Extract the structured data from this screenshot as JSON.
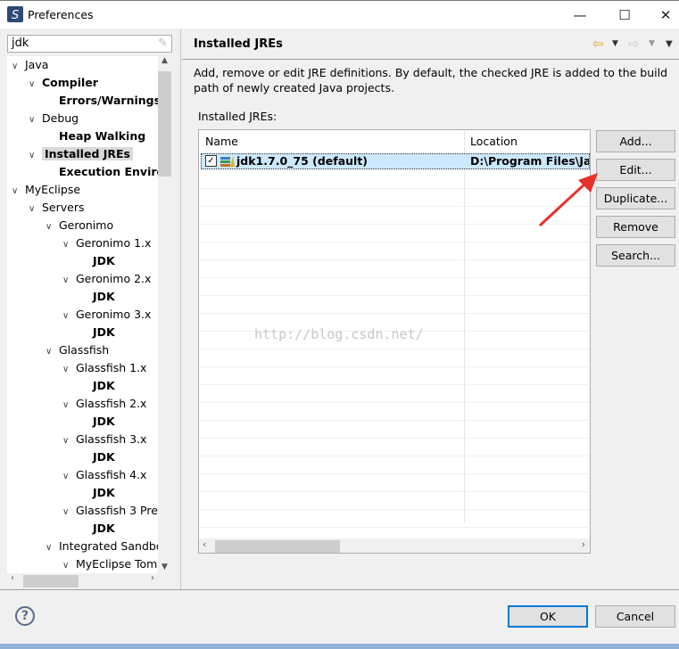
{
  "window": {
    "title": "Preferences",
    "minimize": "—",
    "maximize": "☐",
    "close": "✕"
  },
  "filter": {
    "value": "jdk"
  },
  "tree": [
    {
      "label": "Java",
      "level": 0,
      "expanded": true,
      "bold": false
    },
    {
      "label": "Compiler",
      "level": 1,
      "expanded": true,
      "bold": true
    },
    {
      "label": "Errors/Warnings",
      "level": 2,
      "leaf": true,
      "bold": true
    },
    {
      "label": "Debug",
      "level": 1,
      "expanded": true,
      "bold": false
    },
    {
      "label": "Heap Walking",
      "level": 2,
      "leaf": true,
      "bold": true
    },
    {
      "label": "Installed JREs",
      "level": 1,
      "expanded": true,
      "bold": true,
      "selected": true
    },
    {
      "label": "Execution Environ",
      "level": 2,
      "leaf": true,
      "bold": true
    },
    {
      "label": "MyEclipse",
      "level": 0,
      "expanded": true
    },
    {
      "label": "Servers",
      "level": 1,
      "expanded": true
    },
    {
      "label": "Geronimo",
      "level": 2,
      "expanded": true
    },
    {
      "label": "Geronimo  1.x",
      "level": 3,
      "expanded": true
    },
    {
      "label": "JDK",
      "level": 4,
      "leaf": true,
      "bold": true
    },
    {
      "label": "Geronimo  2.x",
      "level": 3,
      "expanded": true
    },
    {
      "label": "JDK",
      "level": 4,
      "leaf": true,
      "bold": true
    },
    {
      "label": "Geronimo  3.x",
      "level": 3,
      "expanded": true
    },
    {
      "label": "JDK",
      "level": 4,
      "leaf": true,
      "bold": true
    },
    {
      "label": "Glassfish",
      "level": 2,
      "expanded": true
    },
    {
      "label": "Glassfish  1.x",
      "level": 3,
      "expanded": true
    },
    {
      "label": "JDK",
      "level": 4,
      "leaf": true,
      "bold": true
    },
    {
      "label": "Glassfish  2.x",
      "level": 3,
      "expanded": true
    },
    {
      "label": "JDK",
      "level": 4,
      "leaf": true,
      "bold": true
    },
    {
      "label": "Glassfish  3.x",
      "level": 3,
      "expanded": true
    },
    {
      "label": "JDK",
      "level": 4,
      "leaf": true,
      "bold": true
    },
    {
      "label": "Glassfish  4.x",
      "level": 3,
      "expanded": true
    },
    {
      "label": "JDK",
      "level": 4,
      "leaf": true,
      "bold": true
    },
    {
      "label": "Glassfish 3 Pre",
      "level": 3,
      "expanded": true
    },
    {
      "label": "JDK",
      "level": 4,
      "leaf": true,
      "bold": true
    },
    {
      "label": "Integrated Sandbo",
      "level": 2,
      "expanded": true
    },
    {
      "label": "MyEclipse Tom",
      "level": 3,
      "expanded": true
    }
  ],
  "page": {
    "title": "Installed JREs",
    "description": "Add, remove or edit JRE definitions. By default, the checked JRE is added to the build path of newly created Java projects.",
    "list_label": "Installed JREs:",
    "columns": [
      "Name",
      "Location"
    ],
    "rows": [
      {
        "checked": true,
        "name": "jdk1.7.0_75 (default)",
        "location": "D:\\Program Files\\Java"
      }
    ],
    "buttons": [
      "Add...",
      "Edit...",
      "Duplicate...",
      "Remove",
      "Search..."
    ]
  },
  "footer": {
    "ok": "OK",
    "cancel": "Cancel",
    "help": "?"
  },
  "watermark": "http://blog.csdn.net/",
  "colors": {
    "selection": "#cce8ff",
    "default_button_border": "#0078d7",
    "annotation_arrow": "#e8302a"
  }
}
